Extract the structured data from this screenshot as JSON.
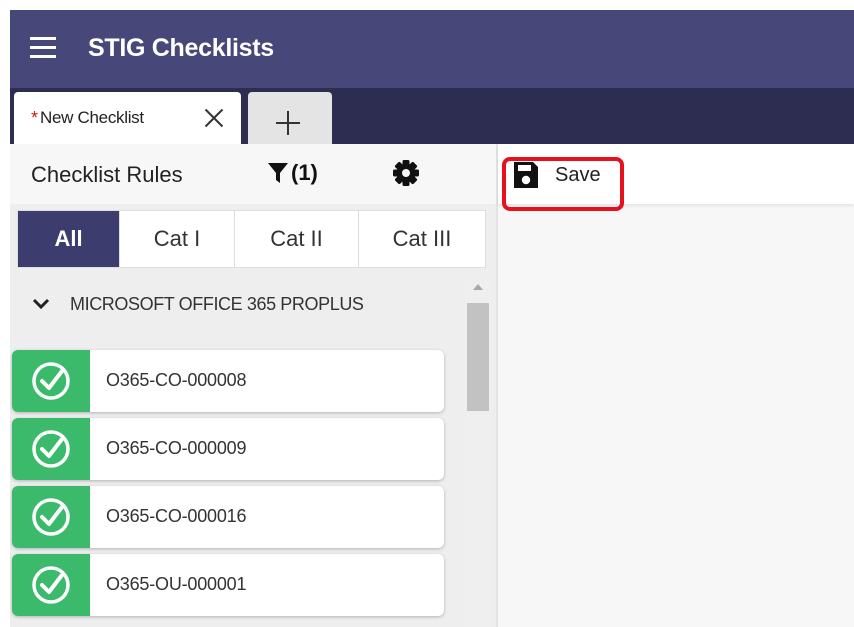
{
  "app": {
    "title": "STIG Checklists"
  },
  "tabs": {
    "active": {
      "modified_marker": "*",
      "label": "New Checklist"
    }
  },
  "sidebar": {
    "title": "Checklist Rules",
    "filter_count": "(1)",
    "categories": [
      {
        "label": "All",
        "active": true
      },
      {
        "label": "Cat I",
        "active": false
      },
      {
        "label": "Cat II",
        "active": false
      },
      {
        "label": "Cat III",
        "active": false
      }
    ],
    "group": {
      "label": "MICROSOFT OFFICE 365 PROPLUS",
      "expanded": true
    },
    "rules": [
      {
        "id": "O365-CO-000008",
        "status_icon": "check-circle-icon"
      },
      {
        "id": "O365-CO-000009",
        "status_icon": "check-circle-icon"
      },
      {
        "id": "O365-CO-000016",
        "status_icon": "check-circle-icon"
      },
      {
        "id": "O365-OU-000001",
        "status_icon": "check-circle-icon"
      }
    ]
  },
  "toolbar": {
    "save_label": "Save"
  },
  "colors": {
    "topbar": "#47477a",
    "tabbar": "#2d2d52",
    "active_category": "#3c3c6e",
    "status_pass": "#3aba6a",
    "highlight": "#e8101a",
    "modified_marker": "#d11a1a"
  }
}
